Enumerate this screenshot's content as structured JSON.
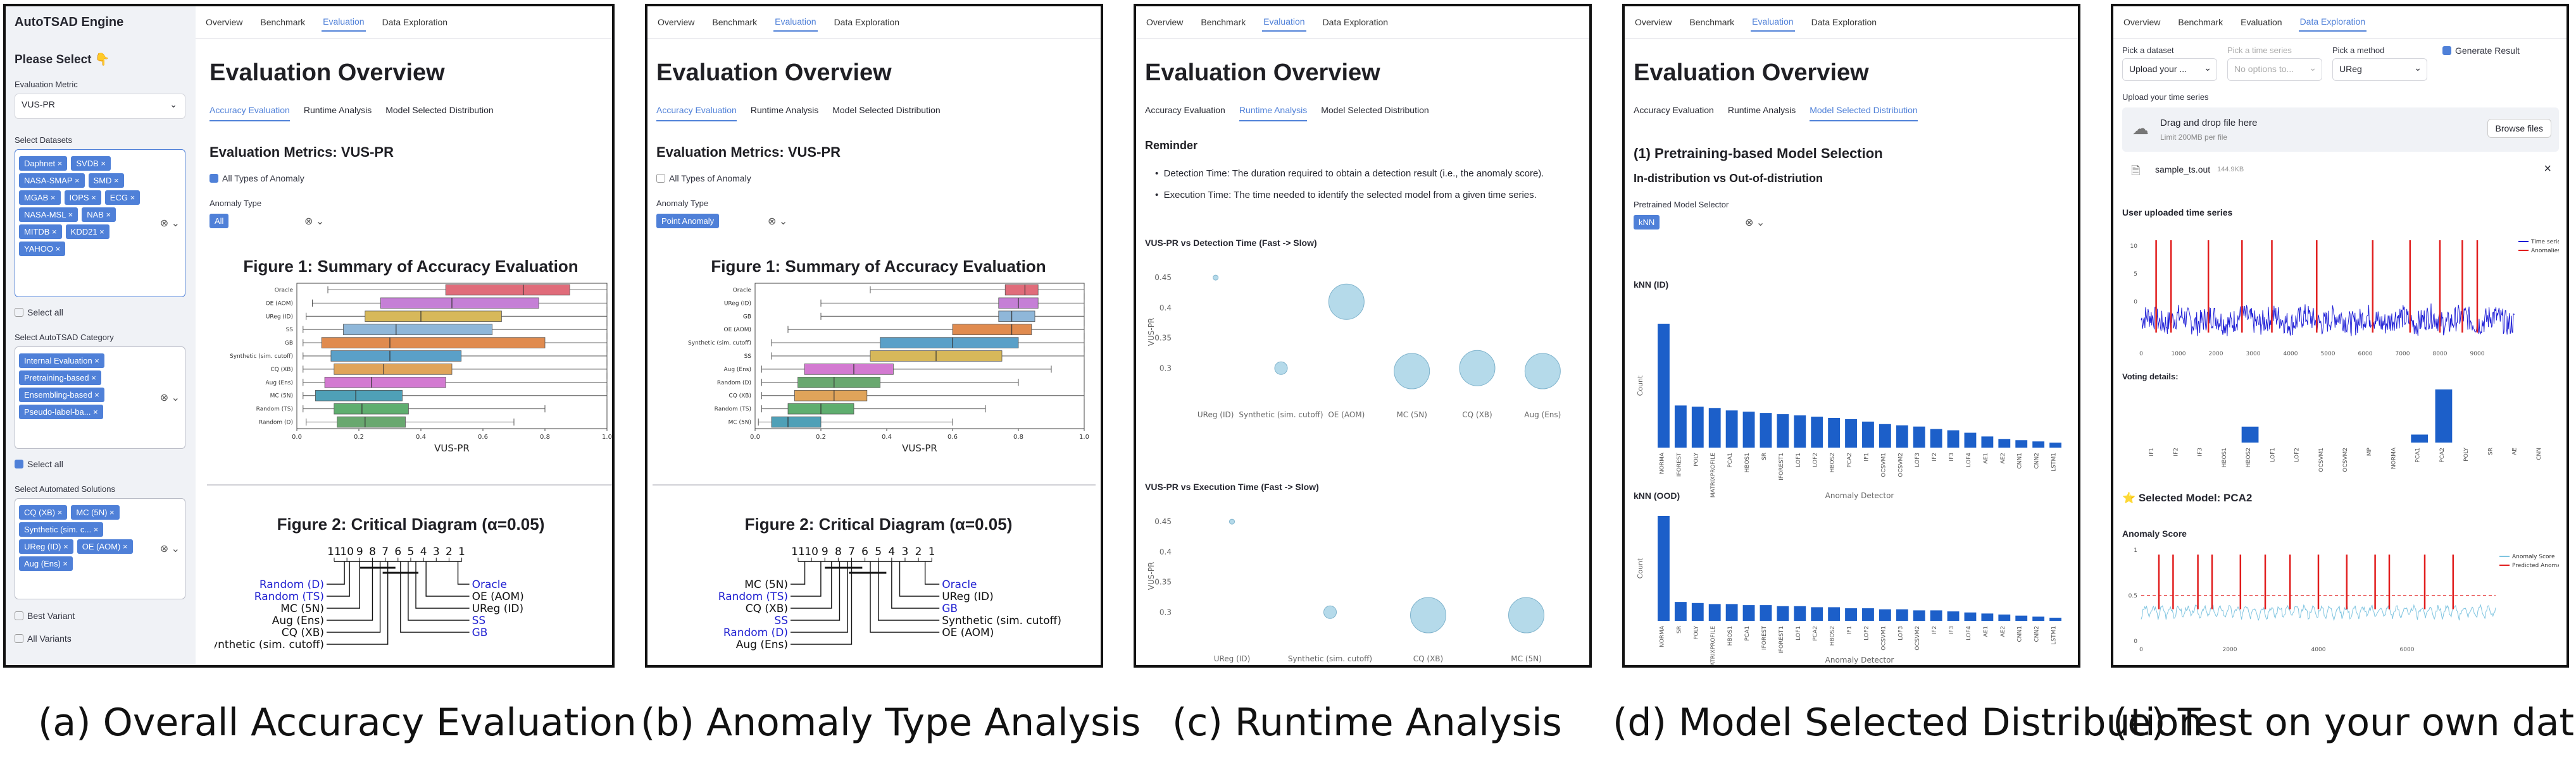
{
  "nav": [
    "Overview",
    "Benchmark",
    "Evaluation",
    "Data Exploration"
  ],
  "subtabs": [
    "Accuracy Evaluation",
    "Runtime Analysis",
    "Model Selected Distribution"
  ],
  "page_title": "Evaluation Overview",
  "captions": [
    "(a) Overall Accuracy Evaluation",
    "(b) Anomaly Type Analysis",
    "(c) Runtime Analysis",
    "(d) Model Selected Distribution",
    "(e) Test on your own data"
  ],
  "sidebar": {
    "app_title": "AutoTSAD Engine",
    "please_select": "Please Select 👇",
    "eval_metric_label": "Evaluation Metric",
    "eval_metric_value": "VUS-PR",
    "datasets_label": "Select Datasets",
    "datasets": [
      "Daphnet",
      "SVDB",
      "NASA-SMAP",
      "SMD",
      "MGAB",
      "IOPS",
      "ECG",
      "NASA-MSL",
      "NAB",
      "MITDB",
      "KDD21",
      "YAHOO"
    ],
    "select_all": "Select all",
    "category_label": "Select AutoTSAD Category",
    "categories": [
      "Internal Evaluation",
      "Pretraining-based",
      "Ensembling-based",
      "Pseudo-label-ba..."
    ],
    "solutions_label": "Select Automated Solutions",
    "solutions": [
      "CQ (XB)",
      "MC (5N)",
      "Synthetic (sim. c...",
      "UReg (ID)",
      "OE (AOM)",
      "Aug (Ens)"
    ],
    "best_variant": "Best Variant",
    "all_variants": "All Variants"
  },
  "panel_a": {
    "metrics_title": "Evaluation Metrics: VUS-PR",
    "all_types": "All Types of Anomaly",
    "anomaly_type_label": "Anomaly Type",
    "anomaly_type_tag": "All",
    "fig1_title": "Figure 1: Summary of Accuracy Evaluation",
    "fig2_title": "Figure 2: Critical Diagram (α=0.05)"
  },
  "panel_b": {
    "metrics_title": "Evaluation Metrics: VUS-PR",
    "all_types": "All Types of Anomaly",
    "anomaly_type_label": "Anomaly Type",
    "anomaly_type_tag": "Point Anomaly",
    "fig1_title": "Figure 1: Summary of Accuracy Evaluation",
    "fig2_title": "Figure 2: Critical Diagram (α=0.05)"
  },
  "panel_c": {
    "reminder": "Reminder",
    "bullets": [
      "Detection Time: The duration required to obtain a detection result (i.e., the anomaly score).",
      "Execution Time: The time needed to identify the selected model from a given time series."
    ],
    "chart1_title": "VUS-PR vs Detection Time (Fast -> Slow)",
    "chart2_title": "VUS-PR vs Execution Time (Fast -> Slow)"
  },
  "panel_d": {
    "section_title": "(1) Pretraining-based Model Selection",
    "sub_title": "In-distribution vs Out-of-distriution",
    "selector_label": "Pretrained Model Selector",
    "selector_tag": "kNN",
    "chart1_title": "kNN (ID)",
    "chart2_title": "kNN (OOD)"
  },
  "panel_e": {
    "pick_dataset": "Pick a dataset",
    "pick_dataset_value": "Upload your ...",
    "pick_series": "Pick a time series",
    "pick_series_value": "No options to...",
    "pick_method": "Pick a method",
    "pick_method_value": "UReg",
    "generate": "Generate Result",
    "upload_label": "Upload your time series",
    "drop_text": "Drag and drop file here",
    "limit_text": "Limit 200MB per file",
    "browse": "Browse files",
    "file_name": "sample_ts.out",
    "file_size": "144.9KB",
    "uploaded_title": "User uploaded time series",
    "voting_title": "Voting details:",
    "selected_model": "⭐ Selected Model: PCA2",
    "anomaly_score_title": "Anomaly Score"
  },
  "chart_data": [
    {
      "type": "box",
      "id": "a_fig1",
      "xlabel": "VUS-PR",
      "xlim": [
        0,
        1.0
      ],
      "xticks": [
        "0.0",
        "0.2",
        "0.4",
        "0.6",
        "0.8",
        "1.0"
      ],
      "categories": [
        "Oracle",
        "OE (AOM)",
        "UReg (ID)",
        "SS",
        "GB",
        "Synthetic (sim. cutoff)",
        "CQ (XB)",
        "Aug (Ens)",
        "MC (5N)",
        "Random (TS)",
        "Random (D)"
      ],
      "boxes": [
        {
          "q1": 0.48,
          "med": 0.73,
          "q3": 0.88,
          "lo": 0.1,
          "hi": 1.0
        },
        {
          "q1": 0.27,
          "med": 0.5,
          "q3": 0.78,
          "lo": 0.05,
          "hi": 1.0
        },
        {
          "q1": 0.22,
          "med": 0.4,
          "q3": 0.66,
          "lo": 0.03,
          "hi": 1.0
        },
        {
          "q1": 0.15,
          "med": 0.32,
          "q3": 0.63,
          "lo": 0.02,
          "hi": 1.0
        },
        {
          "q1": 0.08,
          "med": 0.3,
          "q3": 0.8,
          "lo": 0.02,
          "hi": 1.0
        },
        {
          "q1": 0.11,
          "med": 0.3,
          "q3": 0.53,
          "lo": 0.02,
          "hi": 1.0
        },
        {
          "q1": 0.12,
          "med": 0.28,
          "q3": 0.5,
          "lo": 0.02,
          "hi": 1.0
        },
        {
          "q1": 0.09,
          "med": 0.24,
          "q3": 0.48,
          "lo": 0.02,
          "hi": 1.0
        },
        {
          "q1": 0.06,
          "med": 0.19,
          "q3": 0.34,
          "lo": 0.02,
          "hi": 1.0
        },
        {
          "q1": 0.12,
          "med": 0.21,
          "q3": 0.36,
          "lo": 0.02,
          "hi": 0.8
        },
        {
          "q1": 0.13,
          "med": 0.22,
          "q3": 0.35,
          "lo": 0.03,
          "hi": 0.7
        }
      ],
      "colors": [
        "#e06c7a",
        "#c57fd6",
        "#d7b85a",
        "#8fb7d9",
        "#e08b4f",
        "#5aa0c8",
        "#e0a45a",
        "#d37ad1",
        "#4fa0b7",
        "#5fae6f",
        "#69a86f"
      ]
    },
    {
      "type": "box",
      "id": "b_fig1",
      "xlabel": "VUS-PR",
      "xlim": [
        0,
        1.0
      ],
      "xticks": [
        "0.0",
        "0.2",
        "0.4",
        "0.6",
        "0.8",
        "1.0"
      ],
      "categories": [
        "Oracle",
        "UReg (ID)",
        "GB",
        "OE (AOM)",
        "Synthetic (sim. cutoff)",
        "SS",
        "Aug (Ens)",
        "Random (D)",
        "CQ (XB)",
        "Random (TS)",
        "MC (5N)"
      ],
      "boxes": [
        {
          "q1": 0.76,
          "med": 0.82,
          "q3": 0.86,
          "lo": 0.35,
          "hi": 1.0
        },
        {
          "q1": 0.74,
          "med": 0.8,
          "q3": 0.86,
          "lo": 0.2,
          "hi": 1.0
        },
        {
          "q1": 0.74,
          "med": 0.78,
          "q3": 0.85,
          "lo": 0.2,
          "hi": 1.0
        },
        {
          "q1": 0.6,
          "med": 0.78,
          "q3": 0.84,
          "lo": 0.1,
          "hi": 1.0
        },
        {
          "q1": 0.38,
          "med": 0.6,
          "q3": 0.8,
          "lo": 0.05,
          "hi": 1.0
        },
        {
          "q1": 0.35,
          "med": 0.55,
          "q3": 0.75,
          "lo": 0.05,
          "hi": 1.0
        },
        {
          "q1": 0.15,
          "med": 0.3,
          "q3": 0.42,
          "lo": 0.02,
          "hi": 0.9
        },
        {
          "q1": 0.13,
          "med": 0.24,
          "q3": 0.38,
          "lo": 0.02,
          "hi": 0.8
        },
        {
          "q1": 0.12,
          "med": 0.24,
          "q3": 0.34,
          "lo": 0.02,
          "hi": 1.0
        },
        {
          "q1": 0.1,
          "med": 0.2,
          "q3": 0.3,
          "lo": 0.02,
          "hi": 0.7
        },
        {
          "q1": 0.05,
          "med": 0.1,
          "q3": 0.2,
          "lo": 0.01,
          "hi": 0.6
        }
      ],
      "colors": [
        "#e06c7a",
        "#c57fd6",
        "#8fb7d9",
        "#e08b4f",
        "#5aa0c8",
        "#d7b85a",
        "#d37ad1",
        "#69a86f",
        "#e0a45a",
        "#5fae6f",
        "#4fa0b7"
      ]
    },
    {
      "type": "critical-diagram",
      "id": "a_fig2",
      "ticks": [
        "11",
        "10",
        "9",
        "8",
        "7",
        "6",
        "5",
        "4",
        "3",
        "2",
        "1"
      ],
      "left": [
        {
          "name": "Random (D)",
          "rank": 10.2,
          "color": "#1f1fd1"
        },
        {
          "name": "Random (TS)",
          "rank": 9.8,
          "color": "#1f1fd1"
        },
        {
          "name": "MC (5N)",
          "rank": 9.0,
          "color": "#111"
        },
        {
          "name": "Aug (Ens)",
          "rank": 8.0,
          "color": "#111"
        },
        {
          "name": "CQ (XB)",
          "rank": 7.4,
          "color": "#111"
        },
        {
          "name": "Synthetic (sim. cutoff)",
          "rank": 6.8,
          "color": "#111"
        }
      ],
      "right": [
        {
          "name": "Oracle",
          "rank": 1.3,
          "color": "#1f1fd1"
        },
        {
          "name": "OE (AOM)",
          "rank": 3.8,
          "color": "#111"
        },
        {
          "name": "UReg (ID)",
          "rank": 4.6,
          "color": "#111"
        },
        {
          "name": "SS",
          "rank": 5.2,
          "color": "#1f1fd1"
        },
        {
          "name": "GB",
          "rank": 5.8,
          "color": "#1f1fd1"
        }
      ]
    },
    {
      "type": "critical-diagram",
      "id": "b_fig2",
      "ticks": [
        "11",
        "10",
        "9",
        "8",
        "7",
        "6",
        "5",
        "4",
        "3",
        "2",
        "1"
      ],
      "left": [
        {
          "name": "MC (5N)",
          "rank": 10.5,
          "color": "#111"
        },
        {
          "name": "Random (TS)",
          "rank": 9.3,
          "color": "#1f1fd1"
        },
        {
          "name": "CQ (XB)",
          "rank": 8.5,
          "color": "#111"
        },
        {
          "name": "SS",
          "rank": 7.9,
          "color": "#1f1fd1"
        },
        {
          "name": "Random (D)",
          "rank": 7.3,
          "color": "#1f1fd1"
        },
        {
          "name": "Aug (Ens)",
          "rank": 7.0,
          "color": "#111"
        }
      ],
      "right": [
        {
          "name": "Oracle",
          "rank": 1.5,
          "color": "#1f1fd1"
        },
        {
          "name": "UReg (ID)",
          "rank": 3.4,
          "color": "#111"
        },
        {
          "name": "GB",
          "rank": 4.0,
          "color": "#1f1fd1"
        },
        {
          "name": "Synthetic (sim. cutoff)",
          "rank": 5.0,
          "color": "#111"
        },
        {
          "name": "OE (AOM)",
          "rank": 5.6,
          "color": "#111"
        }
      ]
    },
    {
      "type": "scatter",
      "id": "c_chart1",
      "ylabel": "VUS-PR",
      "ylim": [
        0.25,
        0.47
      ],
      "yticks": [
        "0.45",
        "0.4",
        "0.35",
        "0.3"
      ],
      "categories": [
        "UReg (ID)",
        "Synthetic (sim. cutoff)",
        "OE (AOM)",
        "MC (5N)",
        "CQ (XB)",
        "Aug (Ens)"
      ],
      "values": [
        0.45,
        0.3,
        0.41,
        0.295,
        0.3,
        0.295
      ],
      "sizes": [
        4,
        10,
        28,
        28,
        28,
        28
      ]
    },
    {
      "type": "scatter",
      "id": "c_chart2",
      "ylabel": "VUS-PR",
      "ylim": [
        0.25,
        0.47
      ],
      "yticks": [
        "0.45",
        "0.4",
        "0.35",
        "0.3"
      ],
      "categories": [
        "UReg (ID)",
        "Synthetic (sim. cutoff)",
        "CQ (XB)",
        "MC (5N)"
      ],
      "values": [
        0.45,
        0.3,
        0.295,
        0.295
      ],
      "sizes": [
        4,
        10,
        28,
        28
      ]
    },
    {
      "type": "bar",
      "id": "d_chart1",
      "ylabel": "Count",
      "xlabel": "Anomaly Detector",
      "categories": [
        "NORMA",
        "IFOREST",
        "POLY",
        "MATRIXPROFILE",
        "PCA1",
        "HBOS1",
        "SR",
        "IFOREST1",
        "LOF1",
        "LOF2",
        "HBOS2",
        "PCA2",
        "IF1",
        "OCSVM1",
        "OCSVM2",
        "LOF3",
        "IF2",
        "IF3",
        "LOF4",
        "AE1",
        "AE2",
        "CNN1",
        "CNN2",
        "LSTM1"
      ],
      "values": [
        100,
        34,
        33,
        32,
        30,
        29,
        28,
        27,
        26,
        25,
        24,
        23,
        21,
        19,
        18,
        17,
        15,
        14,
        12,
        9,
        7,
        6,
        5,
        4
      ],
      "color": "#1c5fc9"
    },
    {
      "type": "bar",
      "id": "d_chart2",
      "ylabel": "Count",
      "xlabel": "Anomaly Detector",
      "categories": [
        "NORMA",
        "SR",
        "POLY",
        "MATRIXPROFILE",
        "HBOS1",
        "PCA1",
        "IFOREST",
        "IFOREST1",
        "LOF1",
        "PCA2",
        "HBOS2",
        "IF1",
        "LOF2",
        "OCSVM1",
        "LOF3",
        "OCSVM2",
        "IF2",
        "IF3",
        "LOF4",
        "AE1",
        "AE2",
        "CNN1",
        "CNN2",
        "LSTM1"
      ],
      "values": [
        100,
        18,
        17,
        16,
        16,
        15,
        15,
        14,
        14,
        13,
        13,
        12,
        12,
        11,
        11,
        10,
        10,
        9,
        8,
        7,
        6,
        5,
        4,
        3
      ],
      "color": "#1c5fc9"
    },
    {
      "type": "line",
      "id": "e_ts",
      "legend": [
        "Time series",
        "Anomalies"
      ],
      "xticks": [
        "0",
        "1000",
        "2000",
        "3000",
        "4000",
        "5000",
        "6000",
        "7000",
        "8000",
        "9000"
      ],
      "yticks": [
        "10",
        "5",
        "0"
      ]
    },
    {
      "type": "bar",
      "id": "e_vote",
      "categories": [
        "IF1",
        "IF2",
        "IF3",
        "HBOS1",
        "HBOS2",
        "LOF1",
        "LOF2",
        "OCSVM1",
        "OCSVM2",
        "MP",
        "NORMA",
        "PCA1",
        "PCA2",
        "POLY",
        "SR",
        "AE",
        "CNN"
      ],
      "values": [
        0,
        0,
        0,
        0,
        0.3,
        0,
        0,
        0,
        0,
        0,
        0,
        0.15,
        1.0,
        0,
        0,
        0,
        0
      ],
      "color": "#1c5fc9"
    },
    {
      "type": "line",
      "id": "e_score",
      "legend": [
        "Anomaly Score",
        "Predicted Anomalies"
      ],
      "xticks": [
        "0",
        "2000",
        "4000",
        "6000"
      ],
      "yticks": [
        "1",
        "0.5",
        "0"
      ],
      "threshold": 0.5
    }
  ]
}
